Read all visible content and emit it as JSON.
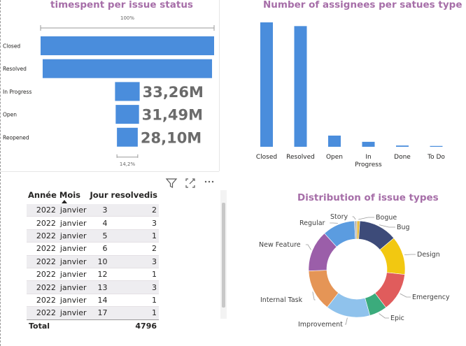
{
  "funnel": {
    "title": "timespent per issue status",
    "top_pct_label": "100%",
    "bottom_pct_label": "14,2%"
  },
  "bar": {
    "title": "Number of assignees per satues type"
  },
  "donut": {
    "title": "Distribution of issue types"
  },
  "table": {
    "headers": [
      "Année",
      "Mois",
      "Jour",
      "resolvedis"
    ],
    "rows": [
      [
        "2022",
        "janvier",
        "3",
        "2"
      ],
      [
        "2022",
        "janvier",
        "4",
        "3"
      ],
      [
        "2022",
        "janvier",
        "5",
        "1"
      ],
      [
        "2022",
        "janvier",
        "6",
        "2"
      ],
      [
        "2022",
        "janvier",
        "10",
        "3"
      ],
      [
        "2022",
        "janvier",
        "12",
        "1"
      ],
      [
        "2022",
        "janvier",
        "13",
        "3"
      ],
      [
        "2022",
        "janvier",
        "14",
        "1"
      ],
      [
        "2022",
        "janvier",
        "17",
        "1"
      ]
    ],
    "total_label": "Total",
    "total_value": "4796"
  },
  "toolbar": {
    "filter_icon": "filter-icon",
    "focus_icon": "focus-mode-icon",
    "more_icon": "more-options-icon"
  },
  "chart_data": [
    {
      "type": "funnel",
      "title": "timespent per issue status",
      "categories": [
        "Closed",
        "Resolved",
        "In Progress",
        "Open",
        "Reopened"
      ],
      "values": [
        234.2,
        228.6,
        33.26,
        31.49,
        28.1
      ],
      "value_unit": "M",
      "data_labels": [
        "",
        "",
        "33,26M",
        "31,49M",
        "28,10M"
      ],
      "color": "#4a8ddc"
    },
    {
      "type": "bar",
      "title": "Number of assignees per satues type",
      "categories": [
        "Closed",
        "Resolved",
        "Open",
        "In Progress",
        "Done",
        "To Do"
      ],
      "values": [
        100,
        97,
        9,
        4,
        1,
        0.5
      ],
      "color": "#4a8ddc"
    },
    {
      "type": "pie",
      "title": "Distribution of issue types",
      "donut": true,
      "slices": [
        {
          "label": "Bogue",
          "value": 1,
          "color": "#e6b93b"
        },
        {
          "label": "Bug",
          "value": 13,
          "color": "#3d4b79"
        },
        {
          "label": "Design",
          "value": 13,
          "color": "#f2c811"
        },
        {
          "label": "Emergency",
          "value": 13,
          "color": "#e05c5c"
        },
        {
          "label": "Epic",
          "value": 6,
          "color": "#3bab7c"
        },
        {
          "label": "Improvement",
          "value": 15,
          "color": "#8fc2ec"
        },
        {
          "label": "Internal Task",
          "value": 14,
          "color": "#e59556"
        },
        {
          "label": "New Feature",
          "value": 14,
          "color": "#9b5ea9"
        },
        {
          "label": "Regular",
          "value": 11,
          "color": "#5b9ce0"
        },
        {
          "label": "Story",
          "value": 0.8,
          "color": "#b9b9b9"
        }
      ]
    }
  ]
}
